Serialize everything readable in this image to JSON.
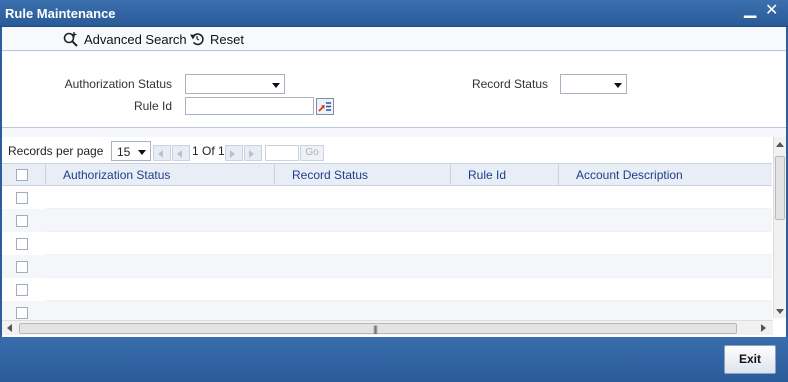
{
  "window": {
    "title": "Rule Maintenance",
    "minimize_glyph": "▁",
    "close_glyph": "✕"
  },
  "toolbar": {
    "advanced_search_label": "Advanced Search",
    "advanced_search_icon": "magnifier-plus-icon",
    "reset_label": "Reset",
    "reset_icon": "undo-icon"
  },
  "criteria": {
    "authorization_status_label": "Authorization Status",
    "authorization_status_value": "",
    "record_status_label": "Record Status",
    "record_status_value": "",
    "rule_id_label": "Rule Id",
    "rule_id_value": "",
    "lov_icon": "list-of-values-icon"
  },
  "pager": {
    "records_per_page_label": "Records per page",
    "records_per_page_value": "15",
    "page_text": "1 Of 1",
    "goto_value": "",
    "go_label": "Go"
  },
  "grid": {
    "columns": [
      "Authorization Status",
      "Record Status",
      "Rule Id",
      "Account Description"
    ],
    "row_count": 6
  },
  "footer": {
    "exit_label": "Exit"
  },
  "colors": {
    "title_bar": "#2d5e9c",
    "header_text": "#1c3f8a",
    "header_bg": "#e9eef6"
  }
}
